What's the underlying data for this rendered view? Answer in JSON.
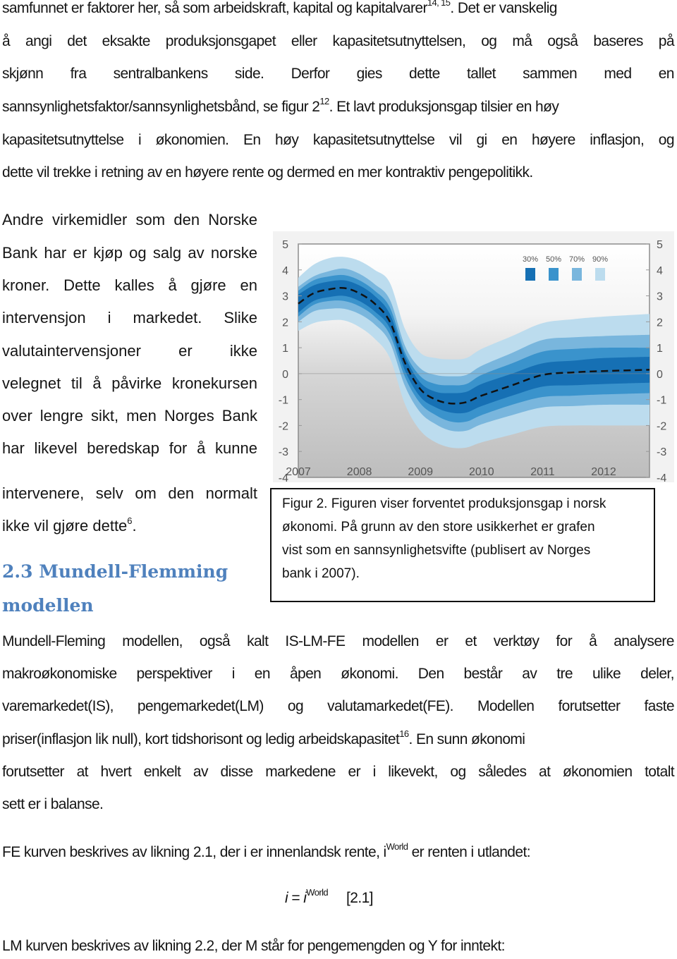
{
  "paragraph1": {
    "lines": [
      {
        "parts": [
          "samfunnet er faktorer her, så som arbeidskraft, kapital og kapitalvarer"
        ],
        "sup": "14, 15",
        "after": ". Det er vanskelig"
      },
      {
        "text": "å angi det eksakte produksjonsgapet eller kapasitetsutnyttelsen, og må også baseres på"
      },
      {
        "text": "skjønn fra sentralbankens side. Derfor gies dette tallet sammen med en"
      },
      {
        "before": "sannsynlighetsfaktor/sannsynlighetsbånd, se figur 2",
        "sup": "12",
        "after": ". Et lavt produksjonsgap tilsier en høy"
      },
      {
        "text": "kapasitetsutnyttelse i økonomien. En høy kapasitetsutnyttelse vil gi en høyere inflasjon, og"
      },
      {
        "text": "dette vil trekke i retning av en høyere rente og dermed en mer kontraktiv pengepolitikk."
      }
    ]
  },
  "paragraph2": {
    "lines": [
      "Andre virkemidler som den Norske",
      "Bank har er kjøp og salg av norske",
      "kroner. Dette kalles å gjøre en",
      "intervensjon i markedet. Slike",
      "valutaintervensjoner er ikke",
      "velegnet til å påvirke kronekursen",
      "over lengre sikt, men Norges Bank",
      "har likevel beredskap for å kunne",
      "intervenere, selv om den normalt"
    ],
    "last_before": "ikke vil gjøre dette",
    "last_sup": "6",
    "last_after": "."
  },
  "heading": {
    "line1": "2.3 Mundell-Flemming",
    "line2": "modellen"
  },
  "figure_caption": {
    "lines": [
      "Figur 2. Figuren viser forventet produksjonsgap i norsk",
      "økonomi. På grunn av den store usikkerhet er grafen",
      "vist som en sannsynlighetsvifte (publisert av Norges",
      "bank i 2007)."
    ]
  },
  "paragraph3": {
    "lines": [
      {
        "text": "Mundell-Fleming modellen, også kalt  IS-LM-FE modellen  er et verktøy for å analysere"
      },
      {
        "text": "makroøkonomiske perspektiver i en åpen økonomi. Den består av tre ulike deler,"
      },
      {
        "text": "varemarkedet(IS), pengemarkedet(LM) og valutamarkedet(FE). Modellen forutsetter faste"
      },
      {
        "before": "priser(inflasjon lik null), kort tidshorisont og ledig arbeidskapasitet",
        "sup": "16",
        "after": ". En sunn økonomi"
      },
      {
        "text": "forutsetter at hvert enkelt av disse markedene er i likevekt, og således at økonomien totalt"
      },
      {
        "text": "sett er i balanse."
      }
    ]
  },
  "fe_text": {
    "before": "FE kurven beskrives av likning 2.1, der i er innenlandsk rente, i",
    "sup": "World",
    "after": " er renten i utlandet:"
  },
  "equation": {
    "lhs": "i",
    "eq": " = ",
    "rhs": "i",
    "rhs_sup": "World",
    "label": "[2.1]"
  },
  "lm_text": "LM kurven beskrives av likning 2.2, der M står for pengemengden og Y for inntekt:",
  "chart_data": {
    "type": "area",
    "title": "",
    "xlabel": "",
    "ylabel": "",
    "x_ticks": [
      "2007",
      "2008",
      "2009",
      "2010",
      "2011",
      "2012"
    ],
    "xlim": [
      2007,
      2012.75
    ],
    "y_ticks": [
      5,
      4,
      3,
      2,
      1,
      0,
      -1,
      -2,
      -3,
      -4
    ],
    "ylim": [
      -4,
      5
    ],
    "y_axis_both_sides": true,
    "zero_line": true,
    "legend": {
      "placement": "top-right",
      "entries": [
        {
          "label": "30%",
          "color": "#1670b4"
        },
        {
          "label": "50%",
          "color": "#3a93cc"
        },
        {
          "label": "70%",
          "color": "#79b6dd"
        },
        {
          "label": "90%",
          "color": "#bcdcee"
        }
      ]
    },
    "x": [
      2007.0,
      2007.25,
      2007.5,
      2007.75,
      2008.0,
      2008.25,
      2008.5,
      2008.75,
      2009.0,
      2009.25,
      2009.5,
      2009.75,
      2010.0,
      2010.5,
      2011.0,
      2011.5,
      2012.0,
      2012.75
    ],
    "median": [
      2.7,
      3.1,
      3.25,
      3.3,
      3.1,
      2.7,
      2.0,
      0.4,
      -0.6,
      -1.0,
      -1.15,
      -1.1,
      -0.85,
      -0.45,
      -0.05,
      0.05,
      0.1,
      0.15
    ],
    "bands": [
      {
        "name": "90%",
        "lower": [
          1.65,
          1.95,
          2.05,
          2.05,
          1.8,
          1.35,
          0.6,
          -1.2,
          -2.2,
          -2.65,
          -2.85,
          -2.85,
          -2.65,
          -2.35,
          -2.05,
          -2.0,
          -2.0,
          -2.0
        ],
        "upper": [
          3.7,
          4.2,
          4.45,
          4.5,
          4.35,
          4.0,
          3.5,
          1.7,
          0.8,
          0.6,
          0.55,
          0.6,
          0.95,
          1.45,
          1.95,
          2.1,
          2.2,
          2.3
        ]
      },
      {
        "name": "70%",
        "lower": [
          2.0,
          2.4,
          2.5,
          2.5,
          2.3,
          1.9,
          1.2,
          -0.5,
          -1.5,
          -1.95,
          -2.2,
          -2.2,
          -1.95,
          -1.6,
          -1.3,
          -1.25,
          -1.2,
          -1.2
        ],
        "upper": [
          3.35,
          3.75,
          3.95,
          4.05,
          3.85,
          3.45,
          2.85,
          1.05,
          0.2,
          -0.05,
          -0.1,
          -0.05,
          0.3,
          0.8,
          1.3,
          1.4,
          1.45,
          1.5
        ]
      },
      {
        "name": "50%",
        "lower": [
          2.2,
          2.65,
          2.8,
          2.8,
          2.6,
          2.2,
          1.5,
          -0.15,
          -1.15,
          -1.6,
          -1.85,
          -1.85,
          -1.6,
          -1.2,
          -0.9,
          -0.85,
          -0.8,
          -0.75
        ],
        "upper": [
          3.2,
          3.6,
          3.75,
          3.8,
          3.6,
          3.2,
          2.55,
          0.8,
          -0.1,
          -0.4,
          -0.45,
          -0.4,
          -0.05,
          0.4,
          0.85,
          0.95,
          1.0,
          1.0
        ]
      },
      {
        "name": "30%",
        "lower": [
          2.35,
          2.8,
          2.95,
          3.0,
          2.8,
          2.4,
          1.75,
          0.1,
          -0.9,
          -1.3,
          -1.5,
          -1.5,
          -1.25,
          -0.85,
          -0.5,
          -0.45,
          -0.4,
          -0.35
        ],
        "upper": [
          3.05,
          3.4,
          3.55,
          3.6,
          3.4,
          3.0,
          2.3,
          0.65,
          -0.35,
          -0.7,
          -0.75,
          -0.7,
          -0.4,
          0.0,
          0.4,
          0.5,
          0.6,
          0.65
        ]
      }
    ],
    "band_colors": {
      "90%": "#bcdcee",
      "70%": "#79b6dd",
      "50%": "#3a93cc",
      "30%": "#1670b4"
    },
    "median_style": "dashed"
  }
}
